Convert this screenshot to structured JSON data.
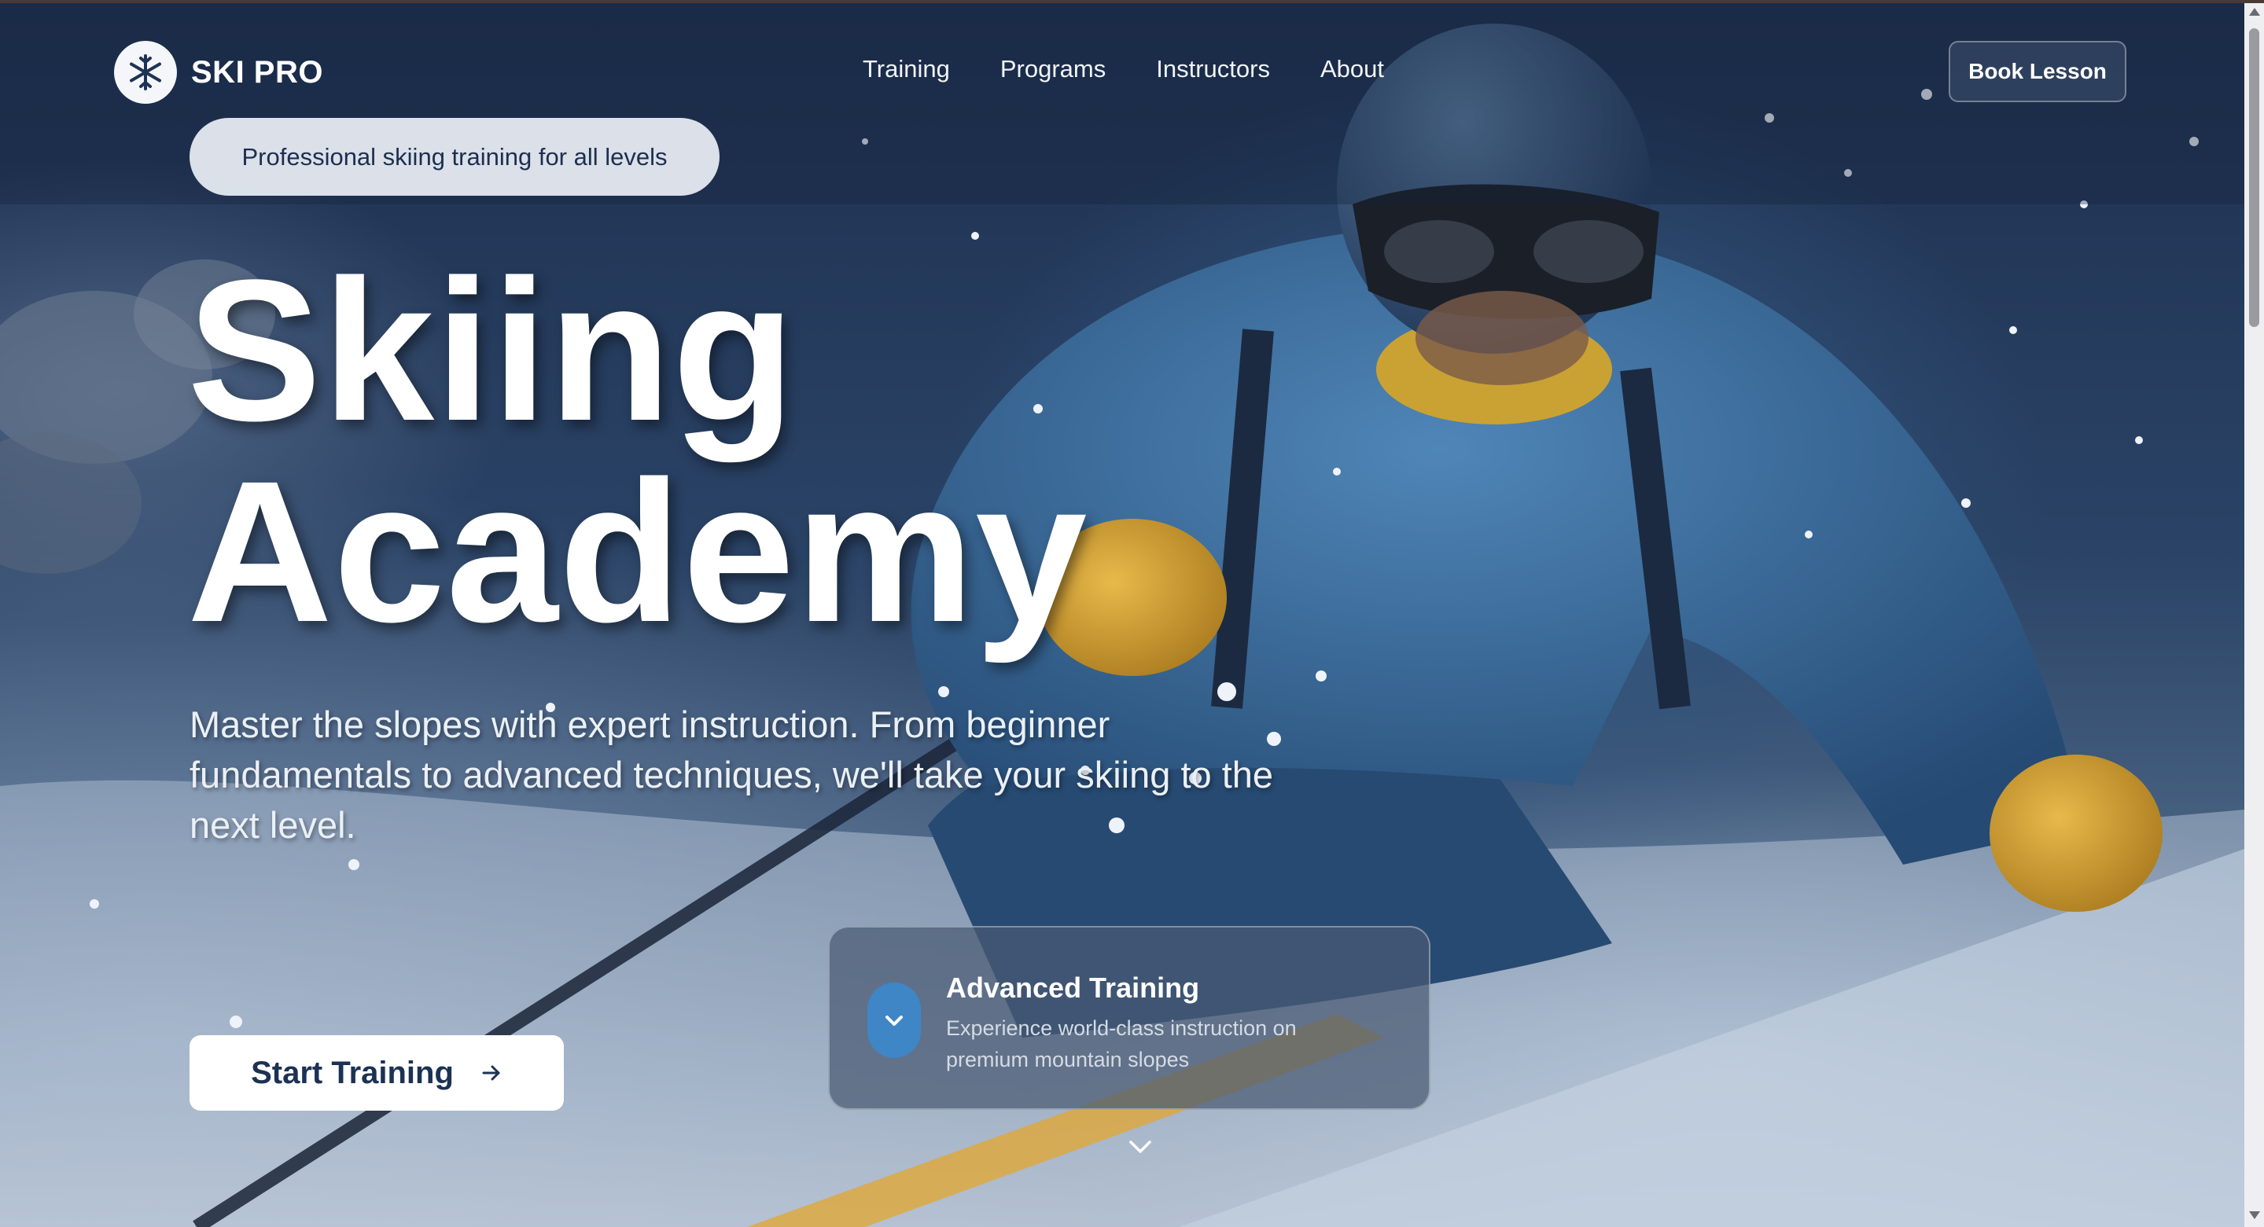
{
  "brand": {
    "name": "SKI PRO",
    "logo_icon": "snowflake-icon"
  },
  "nav": {
    "links": [
      "Training",
      "Programs",
      "Instructors",
      "About"
    ],
    "cta": "Book Lesson"
  },
  "hero": {
    "tagline": "Professional skiing training for all levels",
    "headline_line1": "Skiing",
    "headline_line2": "Academy",
    "description": "Master the slopes with expert instruction. From beginner fundamentals to advanced techniques, we'll take your skiing to the next level.",
    "primary_button": "Start Training",
    "primary_button_icon": "arrow-right-icon"
  },
  "feature_card": {
    "icon": "chevron-down-icon",
    "title": "Advanced Training",
    "description": "Experience world-class instruction on premium mountain slopes"
  },
  "scroll_hint_icon": "chevron-down-icon",
  "colors": {
    "accent": "#3e86c6",
    "text_dark": "#1c3254",
    "background": "#2a4366"
  }
}
